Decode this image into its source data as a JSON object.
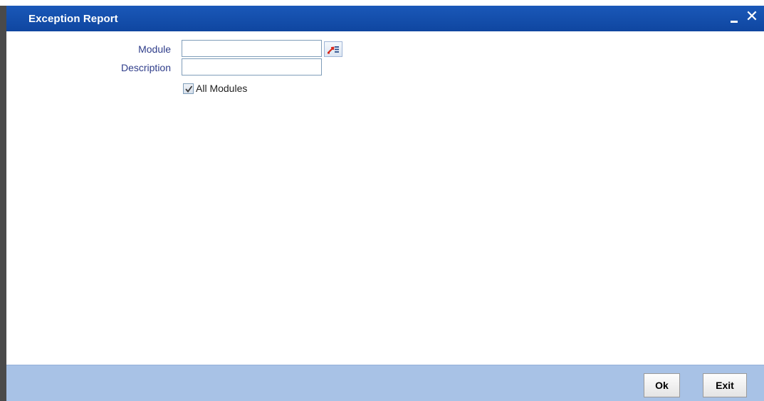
{
  "window": {
    "title": "Exception Report"
  },
  "form": {
    "module_label": "Module",
    "module_value": "",
    "description_label": "Description",
    "description_value": "",
    "all_modules_label": "All Modules",
    "all_modules_checked": true
  },
  "footer": {
    "ok_label": "Ok",
    "exit_label": "Exit"
  },
  "icons": {
    "minimize": "minimize-icon",
    "close": "close-icon",
    "lov": "list-of-values-icon",
    "check": "checkmark-icon"
  },
  "colors": {
    "title_bar": "#1250ae",
    "footer": "#a8c2e6",
    "label": "#2f3d8a"
  }
}
